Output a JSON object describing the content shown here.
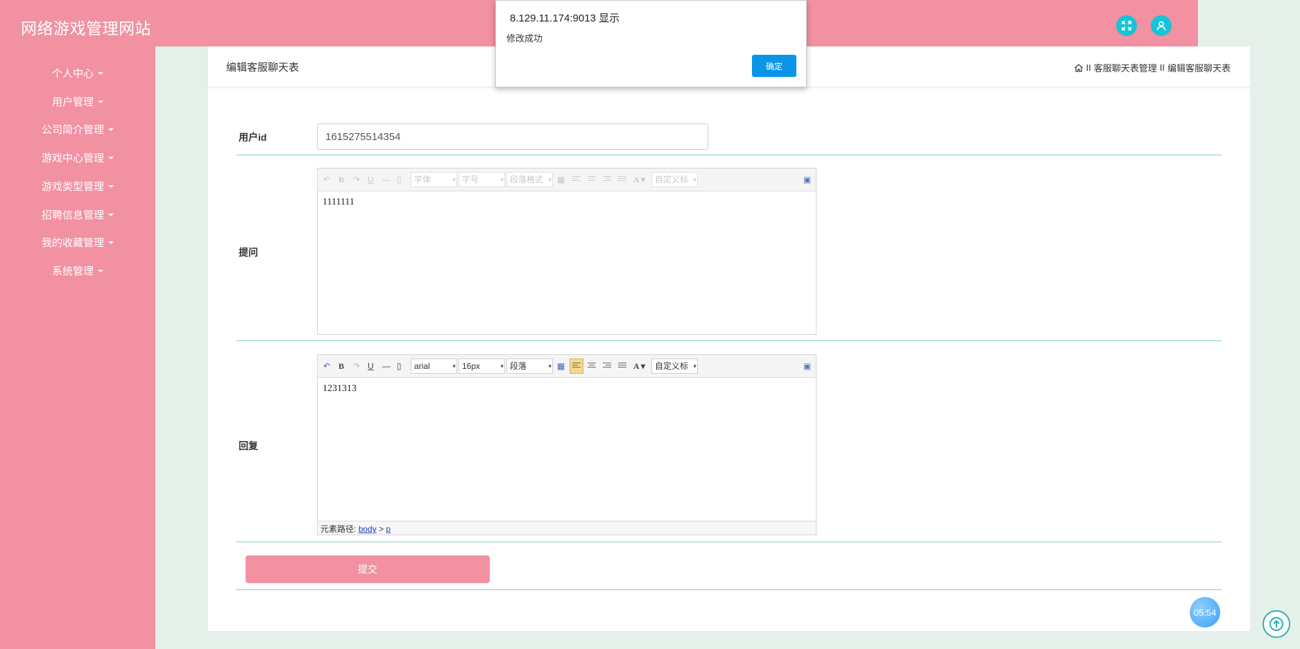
{
  "header": {
    "site_title": "网络游戏管理网站"
  },
  "sidebar": {
    "items": [
      {
        "label": "个人中心"
      },
      {
        "label": "用户管理"
      },
      {
        "label": "公司简介管理"
      },
      {
        "label": "游戏中心管理"
      },
      {
        "label": "游戏类型管理"
      },
      {
        "label": "招聘信息管理"
      },
      {
        "label": "我的收藏管理"
      },
      {
        "label": "系统管理"
      }
    ]
  },
  "page": {
    "title": "编辑客服聊天表",
    "breadcrumb": {
      "sep1": "II",
      "level1": "客服聊天表管理",
      "sep2": "II",
      "level2": "编辑客服聊天表"
    }
  },
  "form": {
    "userid_label": "用户id",
    "userid_value": "1615275514354",
    "question_label": "提问",
    "question_value": "1111111",
    "reply_label": "回复",
    "reply_value": "1231313",
    "submit_label": "提交"
  },
  "editor_toolbar": {
    "disabled": {
      "font": "字体",
      "size": "字号",
      "para": "段落格式",
      "custom": "自定义标"
    },
    "enabled": {
      "font": "arial",
      "size": "16px",
      "para": "段落",
      "custom": "自定义标"
    }
  },
  "editor_status": {
    "prefix": "元素路径:",
    "path1": "body",
    "sep": ">",
    "path2": "p"
  },
  "clock": "05:54",
  "dialog": {
    "title": "8.129.11.174:9013 显示",
    "message": "修改成功",
    "ok_label": "确定"
  },
  "colors": {
    "primary": "#f191a2",
    "accent": "#19c3d6",
    "line": "#82d3c6",
    "ok_button": "#0b95e8"
  }
}
